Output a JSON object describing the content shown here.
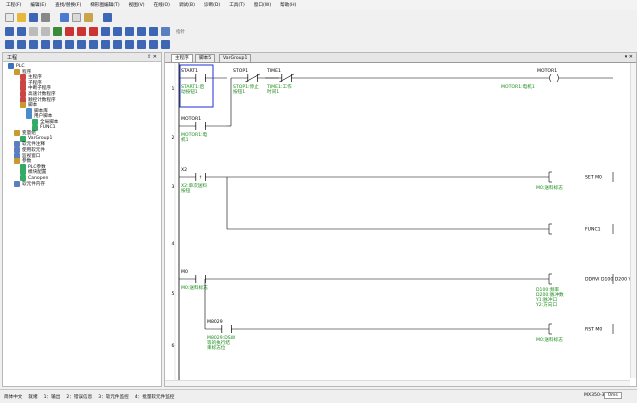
{
  "menu": [
    "工程(F)",
    "编辑(E)",
    "查找/替换(F)",
    "梯形图编辑(T)",
    "视图(V)",
    "在线(O)",
    "调试(B)",
    "诊断(D)",
    "工具(T)",
    "窗口(W)",
    "帮助(H)"
  ],
  "toolbar": {
    "row3_text": "指针"
  },
  "left_panel": {
    "title": "工程",
    "controls": "⇧ ✕",
    "tree": [
      {
        "label": "PLC",
        "depth": 0,
        "color": "#3c73b9"
      },
      {
        "label": "程序",
        "depth": 1,
        "color": "#c99a2e"
      },
      {
        "label": "主程序",
        "depth": 2,
        "color": "#c44"
      },
      {
        "label": "子程序",
        "depth": 2,
        "color": "#c44"
      },
      {
        "label": "中断子程序",
        "depth": 2,
        "color": "#c44"
      },
      {
        "label": "高速计数程序",
        "depth": 2,
        "color": "#c44"
      },
      {
        "label": "顺控计数程序",
        "depth": 2,
        "color": "#c44"
      },
      {
        "label": "脚本",
        "depth": 2,
        "color": "#c99a2e"
      },
      {
        "label": "脚本库",
        "depth": 3,
        "color": "#4a8bc9"
      },
      {
        "label": "用户脚本",
        "depth": 3,
        "color": "#4a8bc9"
      },
      {
        "label": "全局脚本",
        "depth": 4,
        "color": "#3a6"
      },
      {
        "label": "FUNC1",
        "depth": 4,
        "color": "#3a6"
      },
      {
        "label": "变量组",
        "depth": 1,
        "color": "#c99a2e"
      },
      {
        "label": "VarGroup1",
        "depth": 2,
        "color": "#3a6"
      },
      {
        "label": "软元件注释",
        "depth": 1,
        "color": "#5a7fc1"
      },
      {
        "label": "使用软元件",
        "depth": 1,
        "color": "#5a7fc1"
      },
      {
        "label": "监视窗口",
        "depth": 1,
        "color": "#5a7fc1"
      },
      {
        "label": "参数",
        "depth": 1,
        "color": "#c99a2e"
      },
      {
        "label": "PLC参数",
        "depth": 2,
        "color": "#3a6"
      },
      {
        "label": "模块配置",
        "depth": 2,
        "color": "#3a6"
      },
      {
        "label": "Canopen",
        "depth": 2,
        "color": "#3a6"
      },
      {
        "label": "软元件内存",
        "depth": 1,
        "color": "#5a7fc1"
      }
    ]
  },
  "tabs": [
    "主程序",
    "脚本5",
    "VarGroup1"
  ],
  "tab_controls": "▾ ✕",
  "ladder": {
    "rungs": [
      {
        "num": "1",
        "name": "rung-1"
      },
      {
        "num": "2",
        "name": "rung-2"
      },
      {
        "num": "3",
        "name": "rung-3"
      },
      {
        "num": "4",
        "name": "rung-4"
      },
      {
        "num": "5",
        "name": "rung-5"
      },
      {
        "num": "6",
        "name": "rung-6"
      }
    ],
    "contacts": [
      {
        "id": "start1",
        "device": "START1",
        "comment": [
          "START1:启",
          "动按钮1"
        ],
        "type": "no"
      },
      {
        "id": "stop1",
        "device": "STOP1",
        "comment": [
          "STOP1:停止",
          "按钮1"
        ],
        "type": "nc"
      },
      {
        "id": "time1",
        "device": "TIME1",
        "comment": [
          "TIME1:工作",
          "时间1"
        ],
        "type": "nc"
      },
      {
        "id": "motor1-contact",
        "device": "MOTOR1",
        "comment": [
          "MOTOR1:电",
          "机1"
        ],
        "type": "no"
      },
      {
        "id": "x2",
        "device": "X2",
        "comment": [
          "X2:单次送料",
          "按钮"
        ],
        "type": "pulse"
      },
      {
        "id": "m0",
        "device": "M0",
        "comment": [
          "M0:送料标志"
        ],
        "type": "no"
      },
      {
        "id": "m8029",
        "device": "M8029",
        "comment": [
          "M8029:DSW",
          "等的执行结",
          "束标志位"
        ],
        "type": "no"
      }
    ],
    "outputs": [
      {
        "id": "motor1-coil",
        "text": "MOTOR1",
        "comment": [
          "MOTOR1:电机1"
        ]
      },
      {
        "id": "set-m0",
        "text": "SET M0",
        "comment": [
          "M0:送料标志"
        ]
      },
      {
        "id": "func1",
        "text": "FUNC1",
        "comment": []
      },
      {
        "id": "ddrvi",
        "text": "DDRVI D100 D200 Y1 Y2",
        "comment": [
          "D100:频率",
          "D200:脉冲数",
          "Y1:脉冲口",
          "Y2:方向口"
        ]
      },
      {
        "id": "rst-m0",
        "text": "RST M0",
        "comment": [
          "M0:送料标志"
        ]
      }
    ]
  },
  "statusbar": {
    "items": [
      "简体中文",
      "就绪",
      "1：输出",
      "2：错误信息",
      "3：软元件监控",
      "4：批量软元件监控"
    ],
    "model": "MX350-32",
    "scan": "0ms"
  }
}
